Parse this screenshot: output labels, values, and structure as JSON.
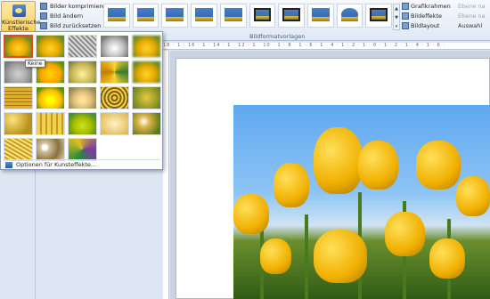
{
  "ribbon": {
    "artistic_effects_label_1": "Künstlerische",
    "artistic_effects_label_2": "Effekte",
    "compress": "Bilder komprimieren",
    "change": "Bild ändern",
    "reset": "Bild zurücksetzen",
    "group_label": "Bildformatvorlagen",
    "border": "Grafikrahmen",
    "effects": "Bildeffekte",
    "layout": "Bildlayout",
    "forward": "Ebene na",
    "backward": "Ebene na",
    "selection": "Auswahl"
  },
  "dropdown": {
    "tooltip": "Keine",
    "options_label": "Optionen für Kunsteffekte..."
  },
  "ruler": {
    "text": "18 · 1 · 16 · 1 · 14 · 1 · 12 · 1 · 10 · 1 · 8 · 1 · 6 · 1 · 4 · 1 · 2 · 1 · 0 · 1 · 2 · 1 · 4 · 1 · 6 ·"
  }
}
